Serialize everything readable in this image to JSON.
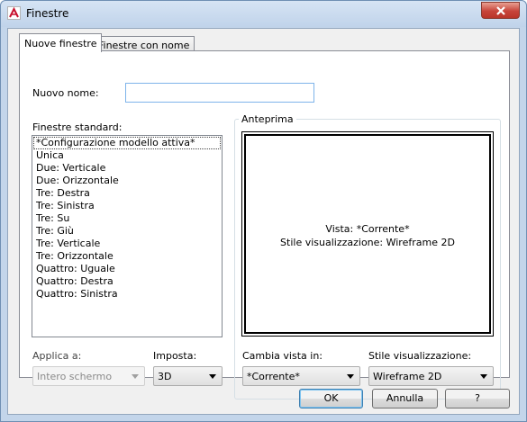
{
  "window": {
    "title": "Finestre",
    "app_icon": "autocad-icon",
    "close_icon": "close-icon"
  },
  "tabs": [
    {
      "label": "Nuove finestre",
      "active": true
    },
    {
      "label": "Finestre con nome",
      "active": false
    }
  ],
  "name_field": {
    "label": "Nuovo nome:",
    "value": "",
    "placeholder": ""
  },
  "standard": {
    "label": "Finestre standard:",
    "items": [
      "*Configurazione modello attiva*",
      "Unica",
      "Due: Verticale",
      "Due: Orizzontale",
      "Tre: Destra",
      "Tre: Sinistra",
      "Tre: Su",
      "Tre: Giù",
      "Tre: Verticale",
      "Tre: Orizzontale",
      "Quattro: Uguale",
      "Quattro: Destra",
      "Quattro: Sinistra"
    ],
    "selected_index": 0
  },
  "preview": {
    "label": "Anteprima",
    "line1": "Vista: *Corrente*",
    "line2": "Stile visualizzazione: Wireframe 2D"
  },
  "apply": {
    "label": "Applica a:",
    "value": "Intero schermo",
    "disabled": true
  },
  "setup": {
    "label": "Imposta:",
    "value": "3D"
  },
  "change_view": {
    "label": "Cambia vista in:",
    "value": "*Corrente*"
  },
  "visual_style": {
    "label": "Stile visualizzazione:",
    "value": "Wireframe 2D"
  },
  "buttons": {
    "ok": "OK",
    "cancel": "Annulla",
    "help": "?"
  },
  "colors": {
    "title_bar": "#c3d5ea",
    "close_button": "#c7443a",
    "focus_border": "#7eb4ea"
  }
}
